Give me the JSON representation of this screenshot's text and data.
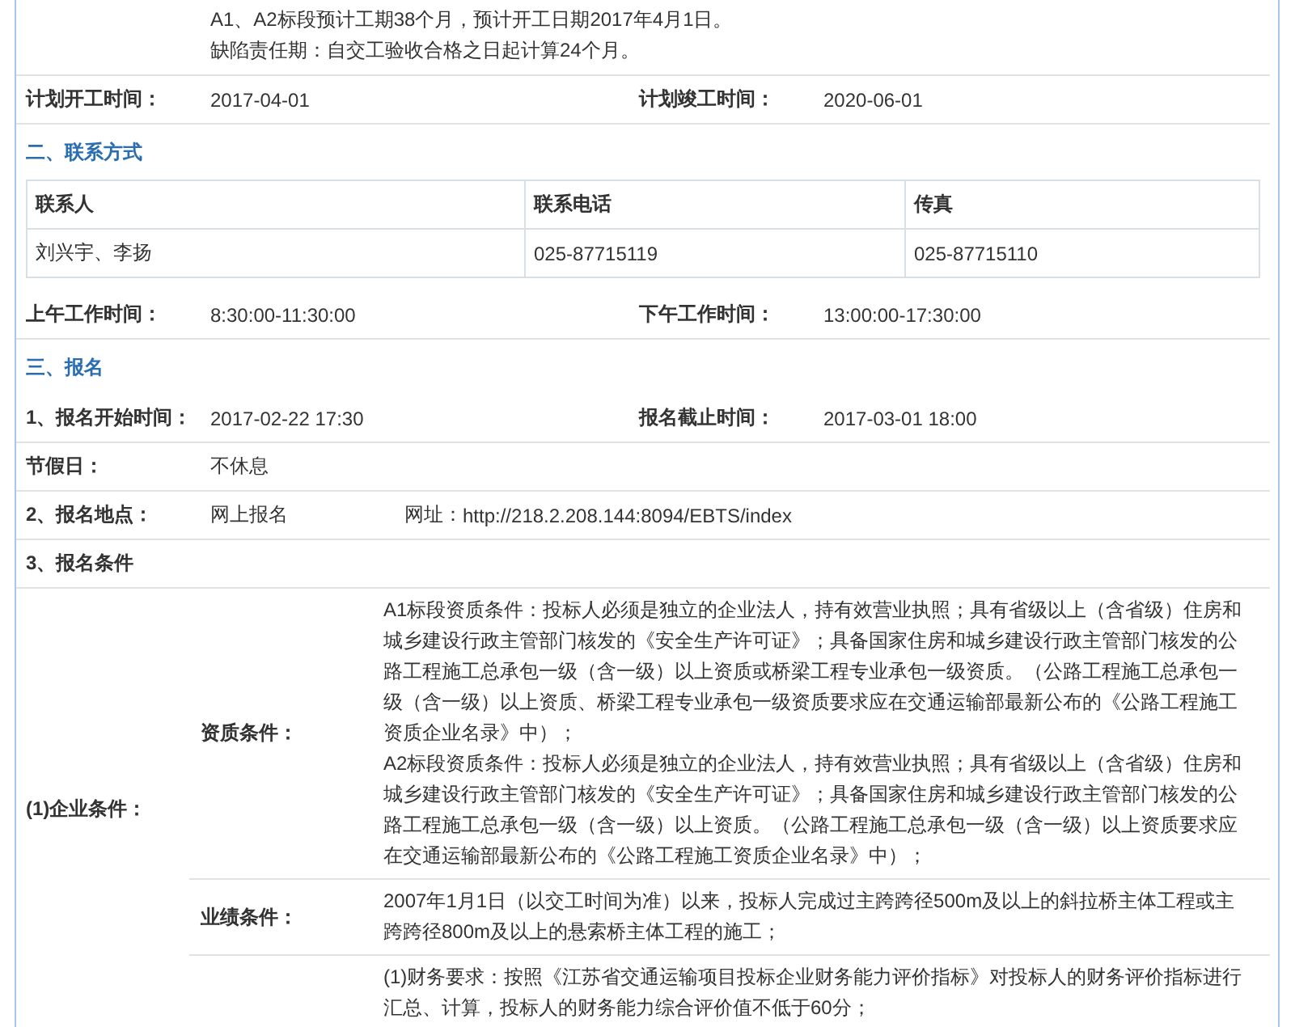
{
  "rows": [
    {
      "kind": "note",
      "lines": [
        "A1、A2标段预计工期38个月，预计开工日期2017年4月1日。",
        "缺陷责任期：自交工验收合格之日起计算24个月。"
      ]
    },
    {
      "kind": "pair",
      "fields": [
        {
          "label": "计划开工时间：",
          "value": "2017-04-01"
        },
        {
          "label": "计划竣工时间：",
          "value": "2020-06-01"
        }
      ]
    },
    {
      "kind": "section",
      "title": "二、联系方式"
    },
    {
      "kind": "contacts",
      "columns": [
        "联系人",
        "联系电话",
        "传真"
      ],
      "rows": [
        [
          "刘兴宇、李扬",
          "025-87715119",
          "025-87715110"
        ]
      ]
    },
    {
      "kind": "pair",
      "fields": [
        {
          "label": "上午工作时间：",
          "value": "8:30:00-11:30:00"
        },
        {
          "label": "下午工作时间：",
          "value": "13:00:00-17:30:00"
        }
      ]
    },
    {
      "kind": "section",
      "title": "三、报名"
    },
    {
      "kind": "pair",
      "fields": [
        {
          "label": "1、报名开始时间：",
          "value": "2017-02-22 17:30"
        },
        {
          "label": "报名截止时间：",
          "value": "2017-03-01 18:00"
        }
      ]
    },
    {
      "kind": "pair",
      "fields": [
        {
          "label": "节假日：",
          "value": "不休息"
        }
      ]
    },
    {
      "kind": "place",
      "label": "2、报名地点：",
      "value": "网上报名",
      "url_label": "网址：",
      "url": "http://218.2.208.144:8094/EBTS/index"
    },
    {
      "kind": "heading",
      "title": "3、报名条件"
    },
    {
      "kind": "conditions",
      "label": "(1)企业条件：",
      "items": [
        {
          "label": "资质条件：",
          "paragraphs": [
            "A1标段资质条件：投标人必须是独立的企业法人，持有效营业执照；具有省级以上（含省级）住房和城乡建设行政主管部门核发的《安全生产许可证》；具备国家住房和城乡建设行政主管部门核发的公路工程施工总承包一级（含一级）以上资质或桥梁工程专业承包一级资质。（公路工程施工总承包一级（含一级）以上资质、桥梁工程专业承包一级资质要求应在交通运输部最新公布的《公路工程施工资质企业名录》中）；",
            "A2标段资质条件：投标人必须是独立的企业法人，持有效营业执照；具有省级以上（含省级）住房和城乡建设行政主管部门核发的《安全生产许可证》；具备国家住房和城乡建设行政主管部门核发的公路工程施工总承包一级（含一级）以上资质。（公路工程施工总承包一级（含一级）以上资质要求应在交通运输部最新公布的《公路工程施工资质企业名录》中）；"
          ]
        },
        {
          "label": "业绩条件：",
          "paragraphs": [
            "2007年1月1日（以交工时间为准）以来，投标人完成过主跨跨径500m及以上的斜拉桥主体工程或主跨跨径800m及以上的悬索桥主体工程的施工；"
          ]
        },
        {
          "paragraphs": [
            "(1)财务要求：按照《江苏省交通运输项目投标企业财务能力评价指标》对投标人的财务评价指标进行汇总、计算，投标人的财务能力综合评价值不低于60分；"
          ]
        }
      ]
    }
  ]
}
